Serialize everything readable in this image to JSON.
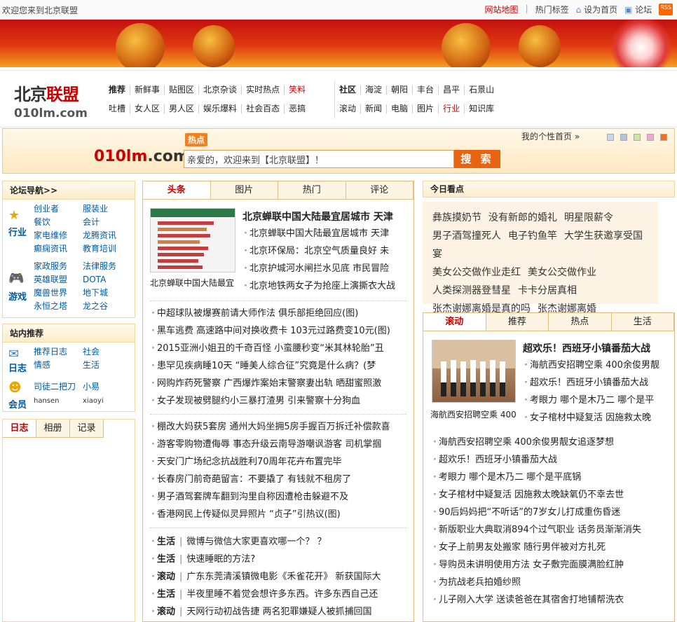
{
  "topbar": {
    "welcome": "欢迎您来到北京联盟",
    "links": [
      "网站地图",
      "热门标签",
      "设为首页",
      "论坛"
    ],
    "rss": "RSS"
  },
  "logo": {
    "cn_a": "北京",
    "cn_b": "联盟",
    "en": "010lm.com"
  },
  "nav": {
    "row1_a": [
      "推荐",
      "新鲜事",
      "贴图区",
      "北京杂谈",
      "实时热点",
      "笑料"
    ],
    "row2_a": [
      "吐槽",
      "女人区",
      "男人区",
      "娱乐爆料",
      "社会百态",
      "恶搞"
    ],
    "row1_b": [
      "社区",
      "海淀",
      "朝阳",
      "丰台",
      "昌平",
      "石景山"
    ],
    "row2_b": [
      "滚动",
      "新闻",
      "电脑",
      "图片",
      "行业",
      "知识库"
    ]
  },
  "search": {
    "hot": "热点",
    "logo_a": "010lm",
    "logo_b": ".com",
    "placeholder": "亲爱的，欢迎来到【北京联盟】！",
    "button": "搜 索",
    "myhome": "我的个性首页 »"
  },
  "forum": {
    "title": "论坛导航>>",
    "cat1": {
      "name": "行业",
      "links": [
        "创业者",
        "服装业",
        "餐饮",
        "会计",
        "家电维修",
        "龙腾资讯",
        "癫痫资讯",
        "教育培训"
      ]
    },
    "cat2": {
      "name": "游戏",
      "links": [
        "家政服务",
        "法律服务",
        "英雄联盟",
        "DOTA",
        "魔兽世界",
        "地下城",
        "永恒之塔",
        "龙之谷"
      ]
    }
  },
  "recommend": {
    "title": "站内推荐",
    "cat1": {
      "name": "日志",
      "links": [
        "推荐日志",
        "社会",
        "情感",
        "生活"
      ]
    },
    "cat2": {
      "name": "会员",
      "links": [
        "司徒二把刀",
        "小易",
        "hansen",
        "xiaoyi"
      ]
    }
  },
  "bottomtabs": [
    "日志",
    "相册",
    "记录"
  ],
  "center": {
    "tabs": [
      "头条",
      "图片",
      "热门",
      "评论"
    ],
    "thumb_caption": "北京蝉联中国大陆最宜",
    "headline": "北京蝉联中国大陆最宜居城市 天津",
    "top_list": [
      "北京蝉联中国大陆最宜居城市 天津",
      "北京环保局：北京空气质量良好 未",
      "北京护城河水闸拦水见底 市民冒险",
      "北京地铁两女子为抢座上演撕衣大战"
    ],
    "list2": [
      "中超球队被爆赛前请大师作法 俱乐部拒绝回应(图)",
      "黑车逃费 高速路中间对换收费卡 103元过路费变10元(图)",
      "2015亚洲小姐丑的千奇百怪 小蛮腰秒变“米其林轮胎”丑",
      "患罕见疾病睡10天 “睡美人综合征”究竟是什么病？(梦",
      "网购炸药死警察 广西爆炸案始末警察妻出轨 晒甜蜜照激",
      "女子发现被劈腿约小三暴打渣男 引来警察十分狗血"
    ],
    "list3": [
      "棚改大妈获5套房 通州大妈坐拥5房手握百万拆迁补偿款喜",
      "游客零购物遭侮辱 事态升级云南导游嘲讽游客 司机掌掴",
      "天安门广场纪念抗战胜利70周年花卉布置完毕",
      "长春房门前奇葩留言：不要撬了 有钱就不租房了",
      "男子酒驾套牌车翻到沟里自称因遭枪击躲避不及",
      "香港网民上传疑似灵异照片 “贞子”引热议(图)"
    ],
    "list4": [
      {
        "tag": "生活",
        "text": "微博与微信大家更喜欢哪一个？ ？"
      },
      {
        "tag": "生活",
        "text": "快速睡眠的方法?"
      },
      {
        "tag": "滚动",
        "text": "广东东莞清溪镇微电影《禾雀花开》 新获国际大"
      },
      {
        "tag": "生活",
        "text": "半夜里睡不着觉会想许多东西。许多东西自己还"
      },
      {
        "tag": "滚动",
        "text": "天网行动初战告捷 两名犯罪嫌疑人被抓捕回国"
      }
    ]
  },
  "today": {
    "title": "今日看点",
    "rows": [
      [
        "彝族摸奶节",
        "没有新郎的婚礼",
        "明星限薪令"
      ],
      [
        "男子酒驾撞死人",
        "电子钓鱼竿",
        "大学生获邀享受国宴"
      ],
      [
        "美女公交做作业走红",
        "美女公交做作业"
      ],
      [
        "人类探测器登彗星",
        "卡卡分居真相"
      ],
      [
        "张杰谢娜离婚是真的吗",
        "张杰谢娜离婚"
      ]
    ]
  },
  "right": {
    "tabs": [
      "滚动",
      "推荐",
      "热点",
      "生活"
    ],
    "thumb_caption": "海航西安招聘空乘 400",
    "headline": "超欢乐！西班牙小镇番茄大战",
    "top_list": [
      "海航西安招聘空乘 400余俊男靓",
      "超欢乐！西班牙小镇番茄大战",
      "考眼力 哪个是木乃二 哪个是平",
      "女子棺材中疑复活 因施救太晚"
    ],
    "list": [
      "海航西安招聘空乘 400余俊男靓女追逐梦想",
      "超欢乐！西班牙小镇番茄大战",
      "考眼力 哪个是木乃二 哪个是平底锅",
      "女子棺材中疑复活 因施救太晚缺氧仍不幸去世",
      "90后妈妈把“不听话”的7岁女儿打成重伤昏迷",
      "新版职业大典取消894个过气职业 话务员渐渐消失",
      "女子上前男友处搬家 随行男伴被对方扎死",
      "导购员未讲明使用方法 女子敷完面膜满脸红肿",
      "为抗战老兵拍婚纱照",
      "儿子刚入大学 送读爸爸在其宿舍打地铺帮洗衣"
    ]
  }
}
